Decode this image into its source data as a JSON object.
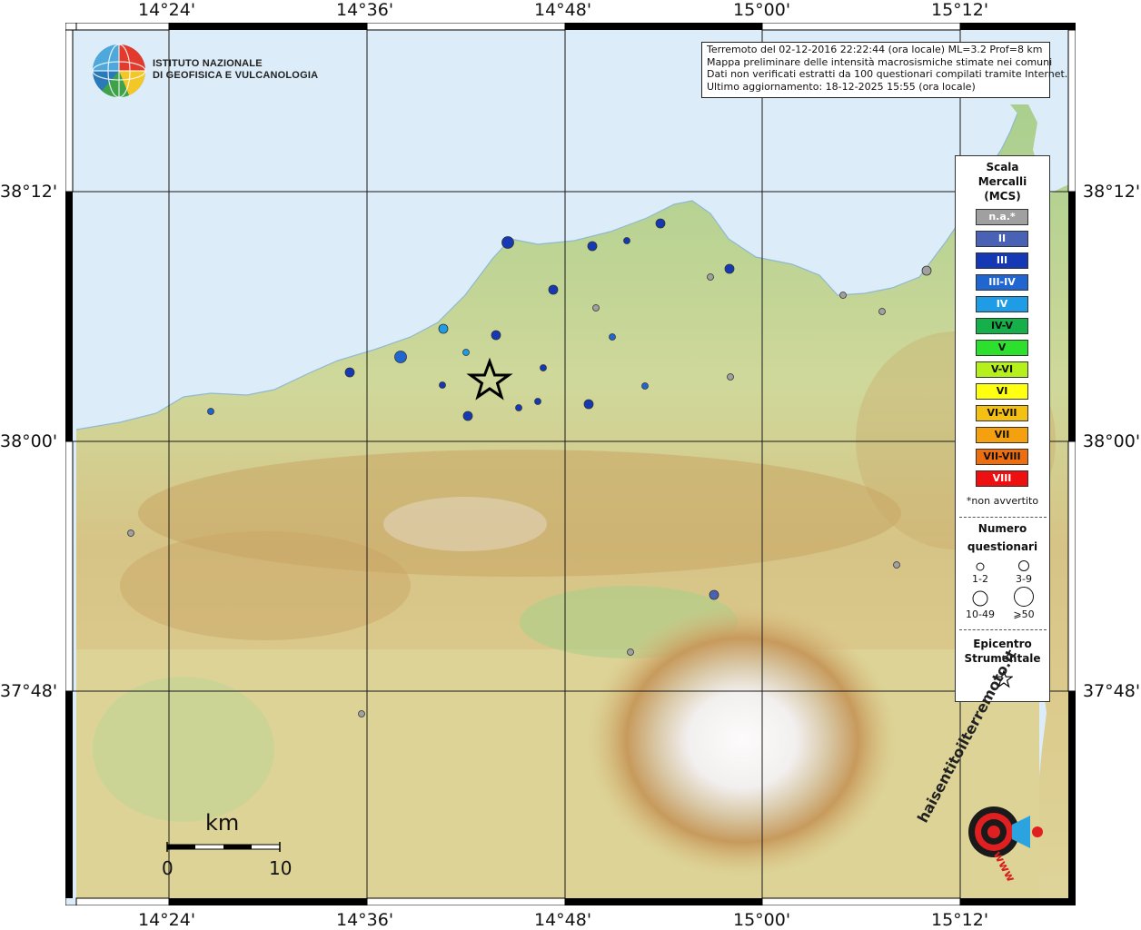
{
  "map": {
    "lon_labels": [
      "14°24'",
      "14°36'",
      "14°48'",
      "15°00'",
      "15°12'"
    ],
    "lat_labels": [
      "38°12'",
      "38°00'",
      "37°48'"
    ]
  },
  "logo": {
    "line1": "ISTITUTO NAZIONALE",
    "line2": "DI GEOFISICA E VULCANOLOGIA"
  },
  "info": {
    "line1": "Terremoto del 02-12-2016 22:22:44 (ora locale) ML=3.2 Prof=8 km",
    "line2": "Mappa preliminare delle intensità macrosismiche stimate nei comuni",
    "line3": "Dati non verificati estratti da 100 questionari compilati tramite Internet.",
    "line4": "Ultimo aggiornamento: 18-12-2025 15:55 (ora locale)"
  },
  "legend": {
    "title_line1": "Scala",
    "title_line2": "Mercalli",
    "title_line3": "(MCS)",
    "classes": [
      {
        "label": "n.a.*",
        "color": "#a0a0a0",
        "text": "#ffffff"
      },
      {
        "label": "II",
        "color": "#4a62b5",
        "text": "#ffffff"
      },
      {
        "label": "III",
        "color": "#1538b4",
        "text": "#ffffff"
      },
      {
        "label": "III-IV",
        "color": "#1f66d1",
        "text": "#ffffff"
      },
      {
        "label": "IV",
        "color": "#1e9ce6",
        "text": "#ffffff"
      },
      {
        "label": "IV-V",
        "color": "#15b04a",
        "text": "#111111"
      },
      {
        "label": "V",
        "color": "#2ee02e",
        "text": "#111111"
      },
      {
        "label": "V-VI",
        "color": "#b6f01c",
        "text": "#111111"
      },
      {
        "label": "VI",
        "color": "#ffff10",
        "text": "#111111"
      },
      {
        "label": "VI-VII",
        "color": "#f4c014",
        "text": "#111111"
      },
      {
        "label": "VII",
        "color": "#f5a00e",
        "text": "#111111"
      },
      {
        "label": "VII-VIII",
        "color": "#ee6d0e",
        "text": "#111111"
      },
      {
        "label": "VIII",
        "color": "#ee1010",
        "text": "#ffffff"
      }
    ],
    "footnote": "*non avvertito",
    "count_title_line1": "Numero",
    "count_title_line2": "questionari",
    "count_classes": [
      "1-2",
      "3-9",
      "10-49",
      "⩾50"
    ],
    "epic_title_line1": "Epicentro",
    "epic_title_line2": "Strumentale"
  },
  "scalebar": {
    "unit": "km",
    "start": "0",
    "end": "10"
  },
  "brand": {
    "text": "haisentitoilterremoto.it",
    "url": "www"
  },
  "colors": {
    "sea": "#dcecf8",
    "epicenter": "#000000"
  }
}
